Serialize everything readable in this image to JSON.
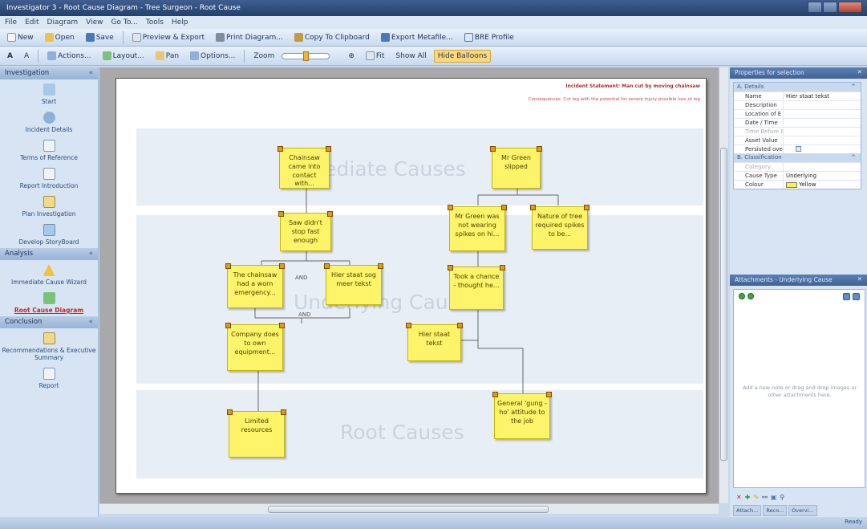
{
  "window": {
    "title": "Investigator 3 - Root Cause Diagram - Tree Surgeon - Root Cause"
  },
  "menu": [
    "File",
    "Edit",
    "Diagram",
    "View",
    "Go To...",
    "Tools",
    "Help"
  ],
  "toolbar1": {
    "new": "New",
    "open": "Open",
    "save": "Save",
    "preview": "Preview & Export",
    "print": "Print Diagram...",
    "copy": "Copy To Clipboard",
    "export_meta": "Export Metafile...",
    "bre": "BRE Profile"
  },
  "toolbar2": {
    "font_up": "A",
    "font_down": "A",
    "actions": "Actions...",
    "layout": "Layout...",
    "pan": "Pan",
    "options": "Options...",
    "zoom": "Zoom",
    "fit": "Fit",
    "show_all": "Show All",
    "hide_balloons": "Hide Balloons"
  },
  "nav": {
    "investigation_header": "Investigation",
    "investigation": [
      "Start",
      "Incident Details",
      "Terms of Reference",
      "Report Introduction",
      "Plan Investigation",
      "Develop StoryBoard"
    ],
    "analysis_header": "Analysis",
    "analysis": [
      "Immediate Cause Wizard",
      "Root Cause Diagram"
    ],
    "conclusion_header": "Conclusion",
    "conclusion": [
      "Recommendations & Executive Summary",
      "Report"
    ]
  },
  "diagram": {
    "incident": "Incident Statement: Man cut by moving chainsaw",
    "consequence": "Consequences: Cut leg with the potential for severe injury possible loss of leg",
    "bands": {
      "immediate": "Immediate Causes",
      "underlying": "Underlying Causes",
      "root": "Root Causes"
    },
    "connector_and": "AND",
    "connector_and_label": "AND",
    "notes": {
      "chainsaw_contact": "Chainsaw came into contact with...",
      "mr_green_slipped": "Mr Green slipped",
      "saw_didnt_stop": "Saw didn't stop fast enough",
      "not_wearing_spikes": "Mr Green was not wearing spikes on hi...",
      "nature_of_tree": "Nature of tree required spikes to be...",
      "emergency": "The chainsaw had a worn emergency...",
      "hier_stast_sog": "Hier staat sog meer tekst",
      "took_chance": "Took a chance - thought he...",
      "company_own_equipment": "Company does to own equipment...",
      "hier_staat_tekst": "Hier staat tekst",
      "limited_resources": "Limited resources",
      "gung_ho": "General 'gung -ho' attitude to the job"
    }
  },
  "properties": {
    "header": "Properties for selection",
    "cat_a": "A. Details",
    "rows_a": [
      {
        "k": "Name",
        "v": "Hier staat tekst"
      },
      {
        "k": "Description",
        "v": ""
      },
      {
        "k": "Location of E",
        "v": ""
      },
      {
        "k": "Date / Time",
        "v": ""
      },
      {
        "k": "Time Before E",
        "v": ""
      },
      {
        "k": "Asset Value",
        "v": ""
      },
      {
        "k": "Persisted over",
        "v": ""
      }
    ],
    "cat_b": "B. Classification",
    "rows_b": [
      {
        "k": "Category",
        "v": ""
      },
      {
        "k": "Cause Type",
        "v": "Underlying"
      },
      {
        "k": "Colour",
        "v": "Yellow"
      }
    ]
  },
  "attachments": {
    "header": "Attachments - Underlying Cause",
    "hint": "Add a new note or drag and drop images or other attachments here.",
    "tabs": [
      "Attach...",
      "Reco...",
      "Overvi..."
    ]
  },
  "status": "Ready",
  "colors": {
    "note_fill": "#fdf46a",
    "accent": "#ffd979",
    "titlebar": "#24406e"
  }
}
